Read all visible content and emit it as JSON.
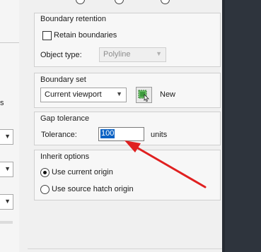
{
  "boundary_retention": {
    "title": "Boundary retention",
    "retain_label": "Retain boundaries",
    "retain_checked": false,
    "object_type_label": "Object type:",
    "object_type_value": "Polyline"
  },
  "boundary_set": {
    "title": "Boundary set",
    "value": "Current viewport",
    "new_label": "New"
  },
  "gap_tolerance": {
    "title": "Gap tolerance",
    "label": "Tolerance:",
    "value": "100",
    "units": "units"
  },
  "inherit_options": {
    "title": "Inherit options",
    "option1": "Use current origin",
    "option2": "Use source hatch origin",
    "selected": "option1"
  },
  "left_panel": {
    "fragment": "s"
  },
  "annotation": {
    "arrow_color": "#e02020"
  }
}
